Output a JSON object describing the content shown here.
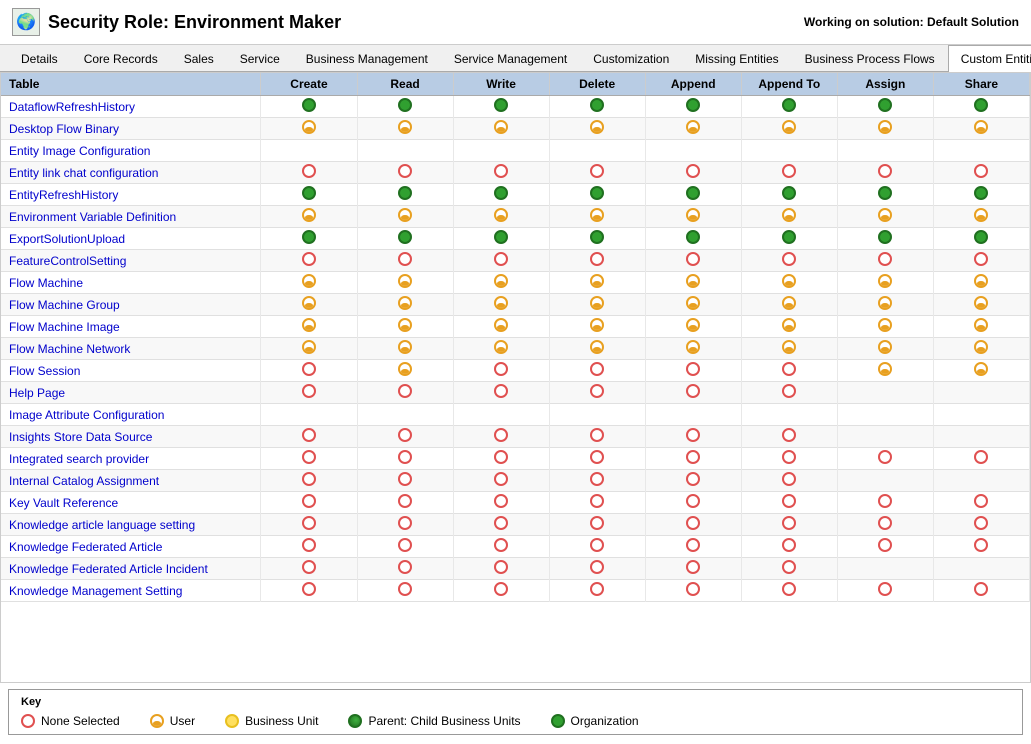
{
  "header": {
    "title": "Security Role: Environment Maker",
    "working_on": "Working on solution: Default Solution",
    "icon": "🌍"
  },
  "tabs": [
    {
      "label": "Details",
      "active": false
    },
    {
      "label": "Core Records",
      "active": false
    },
    {
      "label": "Sales",
      "active": false
    },
    {
      "label": "Service",
      "active": false
    },
    {
      "label": "Business Management",
      "active": false
    },
    {
      "label": "Service Management",
      "active": false
    },
    {
      "label": "Customization",
      "active": false
    },
    {
      "label": "Missing Entities",
      "active": false
    },
    {
      "label": "Business Process Flows",
      "active": false
    },
    {
      "label": "Custom Entities",
      "active": true
    }
  ],
  "table": {
    "columns": [
      "Table",
      "Create",
      "Read",
      "Write",
      "Delete",
      "Append",
      "Append To",
      "Assign",
      "Share"
    ],
    "rows": [
      {
        "name": "DataflowRefreshHistory",
        "create": "org",
        "read": "org",
        "write": "org",
        "delete": "org",
        "append": "org",
        "appendTo": "org",
        "assign": "org",
        "share": "org"
      },
      {
        "name": "Desktop Flow Binary",
        "create": "user",
        "read": "user",
        "write": "user",
        "delete": "user",
        "append": "user",
        "appendTo": "user",
        "assign": "user",
        "share": "user"
      },
      {
        "name": "Entity Image Configuration",
        "create": "",
        "read": "",
        "write": "",
        "delete": "",
        "append": "",
        "appendTo": "",
        "assign": "",
        "share": ""
      },
      {
        "name": "Entity link chat configuration",
        "create": "none",
        "read": "none",
        "write": "none",
        "delete": "none",
        "append": "none",
        "appendTo": "none",
        "assign": "none",
        "share": "none"
      },
      {
        "name": "EntityRefreshHistory",
        "create": "org",
        "read": "org",
        "write": "org",
        "delete": "org",
        "append": "org",
        "appendTo": "org",
        "assign": "org",
        "share": "org"
      },
      {
        "name": "Environment Variable Definition",
        "create": "user",
        "read": "user",
        "write": "user",
        "delete": "user",
        "append": "user",
        "appendTo": "user",
        "assign": "user",
        "share": "user"
      },
      {
        "name": "ExportSolutionUpload",
        "create": "org",
        "read": "org",
        "write": "org",
        "delete": "org",
        "append": "org",
        "appendTo": "org",
        "assign": "org",
        "share": "org"
      },
      {
        "name": "FeatureControlSetting",
        "create": "none",
        "read": "none",
        "write": "none",
        "delete": "none",
        "append": "none",
        "appendTo": "none",
        "assign": "none",
        "share": "none"
      },
      {
        "name": "Flow Machine",
        "create": "user",
        "read": "user",
        "write": "user",
        "delete": "user",
        "append": "user",
        "appendTo": "user",
        "assign": "user",
        "share": "user"
      },
      {
        "name": "Flow Machine Group",
        "create": "user",
        "read": "user",
        "write": "user",
        "delete": "user",
        "append": "user",
        "appendTo": "user",
        "assign": "user",
        "share": "user"
      },
      {
        "name": "Flow Machine Image",
        "create": "user",
        "read": "user",
        "write": "user",
        "delete": "user",
        "append": "user",
        "appendTo": "user",
        "assign": "user",
        "share": "user"
      },
      {
        "name": "Flow Machine Network",
        "create": "user",
        "read": "user",
        "write": "user",
        "delete": "user",
        "append": "user",
        "appendTo": "user",
        "assign": "user",
        "share": "user"
      },
      {
        "name": "Flow Session",
        "create": "none",
        "read": "user",
        "write": "none",
        "delete": "none",
        "append": "none",
        "appendTo": "none",
        "assign": "user",
        "share": "user"
      },
      {
        "name": "Help Page",
        "create": "none",
        "read": "none",
        "write": "none",
        "delete": "none",
        "append": "none",
        "appendTo": "none",
        "assign": "",
        "share": ""
      },
      {
        "name": "Image Attribute Configuration",
        "create": "",
        "read": "",
        "write": "",
        "delete": "",
        "append": "",
        "appendTo": "",
        "assign": "",
        "share": ""
      },
      {
        "name": "Insights Store Data Source",
        "create": "none",
        "read": "none",
        "write": "none",
        "delete": "none",
        "append": "none",
        "appendTo": "none",
        "assign": "",
        "share": ""
      },
      {
        "name": "Integrated search provider",
        "create": "none",
        "read": "none",
        "write": "none",
        "delete": "none",
        "append": "none",
        "appendTo": "none",
        "assign": "none",
        "share": "none"
      },
      {
        "name": "Internal Catalog Assignment",
        "create": "none",
        "read": "none",
        "write": "none",
        "delete": "none",
        "append": "none",
        "appendTo": "none",
        "assign": "",
        "share": ""
      },
      {
        "name": "Key Vault Reference",
        "create": "none",
        "read": "none",
        "write": "none",
        "delete": "none",
        "append": "none",
        "appendTo": "none",
        "assign": "none",
        "share": "none"
      },
      {
        "name": "Knowledge article language setting",
        "create": "none",
        "read": "none",
        "write": "none",
        "delete": "none",
        "append": "none",
        "appendTo": "none",
        "assign": "none",
        "share": "none"
      },
      {
        "name": "Knowledge Federated Article",
        "create": "none",
        "read": "none",
        "write": "none",
        "delete": "none",
        "append": "none",
        "appendTo": "none",
        "assign": "none",
        "share": "none"
      },
      {
        "name": "Knowledge Federated Article Incident",
        "create": "none",
        "read": "none",
        "write": "none",
        "delete": "none",
        "append": "none",
        "appendTo": "none",
        "assign": "",
        "share": ""
      },
      {
        "name": "Knowledge Management Setting",
        "create": "none",
        "read": "none",
        "write": "none",
        "delete": "none",
        "append": "none",
        "appendTo": "none",
        "assign": "none",
        "share": "none"
      }
    ]
  },
  "key": {
    "title": "Key",
    "items": [
      {
        "label": "None Selected",
        "type": "none"
      },
      {
        "label": "User",
        "type": "user"
      },
      {
        "label": "Business Unit",
        "type": "business-unit"
      },
      {
        "label": "Parent: Child Business Units",
        "type": "parent-child"
      },
      {
        "label": "Organization",
        "type": "org"
      }
    ]
  }
}
